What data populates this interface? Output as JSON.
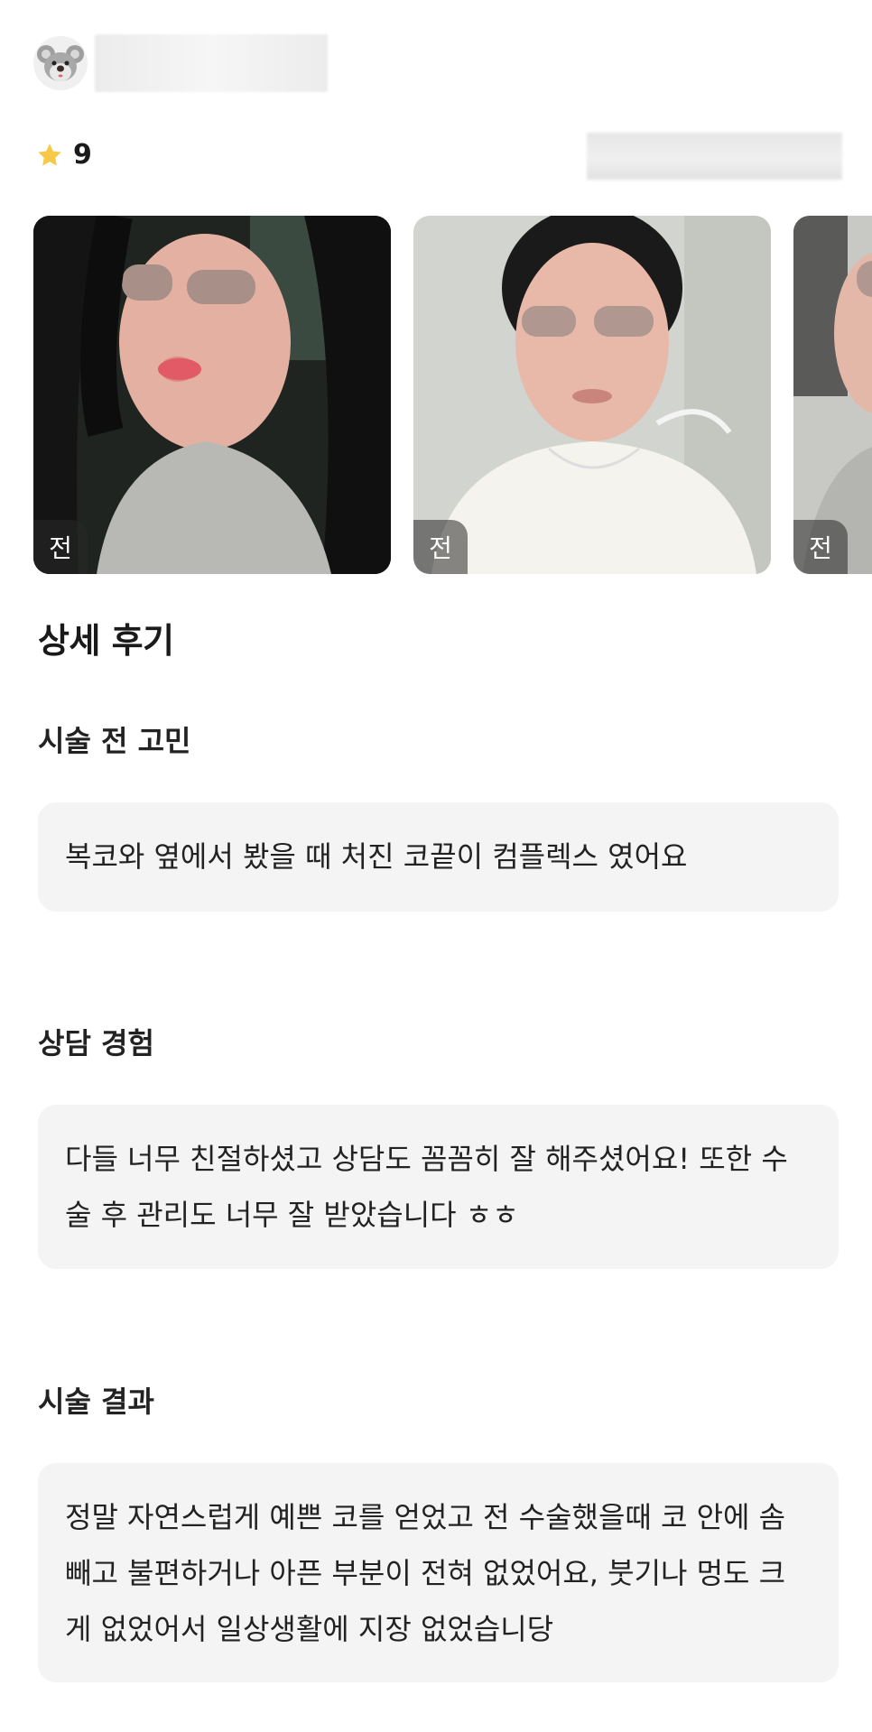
{
  "rating": {
    "value": "9",
    "icon": "star-icon",
    "icon_color": "#f7c948"
  },
  "gallery": {
    "badge_label": "전"
  },
  "review": {
    "section_title": "상세 후기",
    "questions": [
      {
        "title": "시술 전 고민",
        "answer": "복코와 옆에서 봤을 때 처진 코끝이 컴플렉스 였어요"
      },
      {
        "title": "상담 경험",
        "answer": "다들 너무 친절하셨고 상담도 꼼꼼히 잘 해주셨어요! 또한 수술 후 관리도 너무 잘 받았습니다 ㅎㅎ"
      },
      {
        "title": "시술 결과",
        "answer": "정말 자연스럽게 예쁜 코를 얻었고 전 수술했을때 코 안에 솜 빼고 불편하거나 아픈 부분이 전혀 없었어요, 붓기나 멍도 크게 없었어서 일상생활에 지장 없었습니당"
      }
    ]
  },
  "colors": {
    "answer_bg": "#f4f4f4",
    "text": "#1a1a1a"
  }
}
